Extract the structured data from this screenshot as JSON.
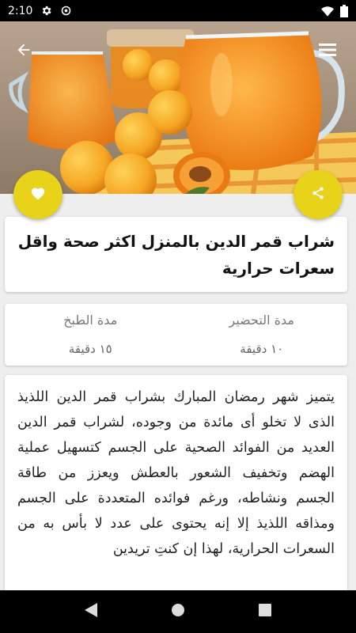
{
  "status_bar": {
    "time": "2:10"
  },
  "recipe": {
    "title": "شراب قمر الدين بالمنزل اكثر صحة واقل سعرات حرارية",
    "prep_label": "مدة التحضير",
    "prep_value": "١٠ دقيقة",
    "cook_label": "مدة الطبخ",
    "cook_value": "١٥ دقيقة",
    "description": "يتميز شهر رمضان المبارك بشراب قمر الدين اللذيذ الذى لا تخلو أى مائدة من وجوده، لشراب قمر الدين العديد من الفوائد الصحية على الجسم كتسهيل عملية الهضم وتخفيف الشعور بالعطش ويعزز من طاقة الجسم ونشاطه، ورغم فوائده المتعددة على الجسم ومذاقه اللذيذ إلا إنه يحتوى على عدد لا بأس به من السعرات الحرارية، لهذا إن كنتِ تريدين"
  },
  "icons": {
    "back": "arrow-back-icon",
    "menu": "hamburger-menu-icon",
    "like": "heart-icon",
    "share": "share-icon"
  },
  "colors": {
    "accent": "#e8d21a"
  }
}
